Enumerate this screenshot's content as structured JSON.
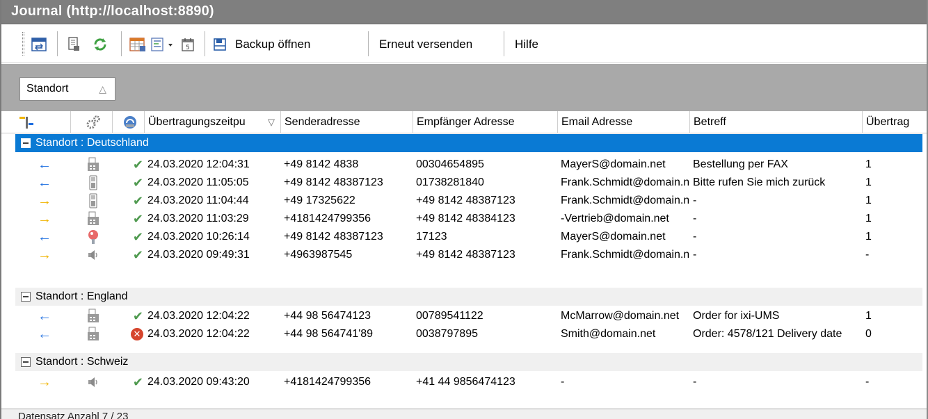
{
  "window": {
    "title": "Journal (http://localhost:8890)"
  },
  "toolbar": {
    "icons": [
      "refresh-view-icon",
      "print-icon",
      "sync-icon",
      "grid-layout-icon",
      "list-icon",
      "calendar-icon",
      "backup-icon"
    ],
    "buttons": {
      "backup": "Backup öffnen",
      "resend": "Erneut versenden",
      "help": "Hilfe"
    }
  },
  "groupbar": {
    "chip_label": "Standort",
    "sort_indicator": "△"
  },
  "columns": {
    "time": "Übertragungszeitpu",
    "sender": "Senderadresse",
    "recipient": "Empfänger Adresse",
    "email": "Email Adresse",
    "subject": "Betreff",
    "transfer": "Übertrag",
    "sort_indicator": "▽"
  },
  "groups": [
    {
      "label": "Standort : Deutschland",
      "rows": [
        {
          "direction": "in",
          "device": "fax",
          "status": "ok",
          "time": "24.03.2020 12:04:31",
          "sender": "+49 8142 4838",
          "recipient": "00304654895",
          "email": "MayerS@domain.net",
          "subject": "Bestellung per FAX",
          "transfer": "1"
        },
        {
          "direction": "in",
          "device": "mobile",
          "status": "ok",
          "time": "24.03.2020 11:05:05",
          "sender": "+49 8142 48387123",
          "recipient": "01738281840",
          "email": "Frank.Schmidt@domain.net",
          "subject": "Bitte rufen Sie mich zurück",
          "transfer": "1"
        },
        {
          "direction": "out",
          "device": "mobile",
          "status": "ok",
          "time": "24.03.2020 11:04:44",
          "sender": "+49 17325622",
          "recipient": "+49 8142 48387123",
          "email": "Frank.Schmidt@domain.net",
          "subject": "-",
          "transfer": "1"
        },
        {
          "direction": "out",
          "device": "fax",
          "status": "ok",
          "time": "24.03.2020 11:03:29",
          "sender": "+4181424799356",
          "recipient": "+49 8142 48384123",
          "email": "-Vertrieb@domain.net",
          "subject": "-",
          "transfer": "1"
        },
        {
          "direction": "in",
          "device": "pin",
          "status": "ok",
          "time": "24.03.2020 10:26:14",
          "sender": "+49 8142 48387123",
          "recipient": "17123",
          "email": "MayerS@domain.net",
          "subject": "-",
          "transfer": "1"
        },
        {
          "direction": "out",
          "device": "speaker",
          "status": "ok",
          "time": "24.03.2020 09:49:31",
          "sender": "+4963987545",
          "recipient": "+49 8142 48387123",
          "email": "Frank.Schmidt@domain.net",
          "subject": "-",
          "transfer": "-"
        }
      ]
    },
    {
      "label": "Standort : England",
      "rows": [
        {
          "direction": "in",
          "device": "fax",
          "status": "ok",
          "time": "24.03.2020 12:04:22",
          "sender": "+44 98 56474123",
          "recipient": "00789541122",
          "email": "McMarrow@domain.net",
          "subject": "Order for ixi-UMS",
          "transfer": "1"
        },
        {
          "direction": "in",
          "device": "fax",
          "status": "error",
          "time": "24.03.2020 12:04:22",
          "sender": "+44 98 564741'89",
          "recipient": "0038797895",
          "email": "Smith@domain.net",
          "subject": "Order: 4578/121 Delivery date",
          "transfer": "0"
        }
      ]
    },
    {
      "label": "Standort : Schweiz",
      "rows": [
        {
          "direction": "out",
          "device": "speaker",
          "status": "ok",
          "time": "24.03.2020 09:43:20",
          "sender": "+4181424799356",
          "recipient": "+41 44 9856474123",
          "email": "-",
          "subject": "-",
          "transfer": "-"
        }
      ]
    }
  ],
  "statusbar": {
    "text": "Datensatz Anzahl 7 / 23"
  },
  "colors": {
    "selection": "#0a7ad4",
    "incoming_arrow": "#1f6fe0",
    "outgoing_arrow": "#f0b400",
    "ok_check": "#4f9a4f",
    "error": "#d6452d"
  }
}
